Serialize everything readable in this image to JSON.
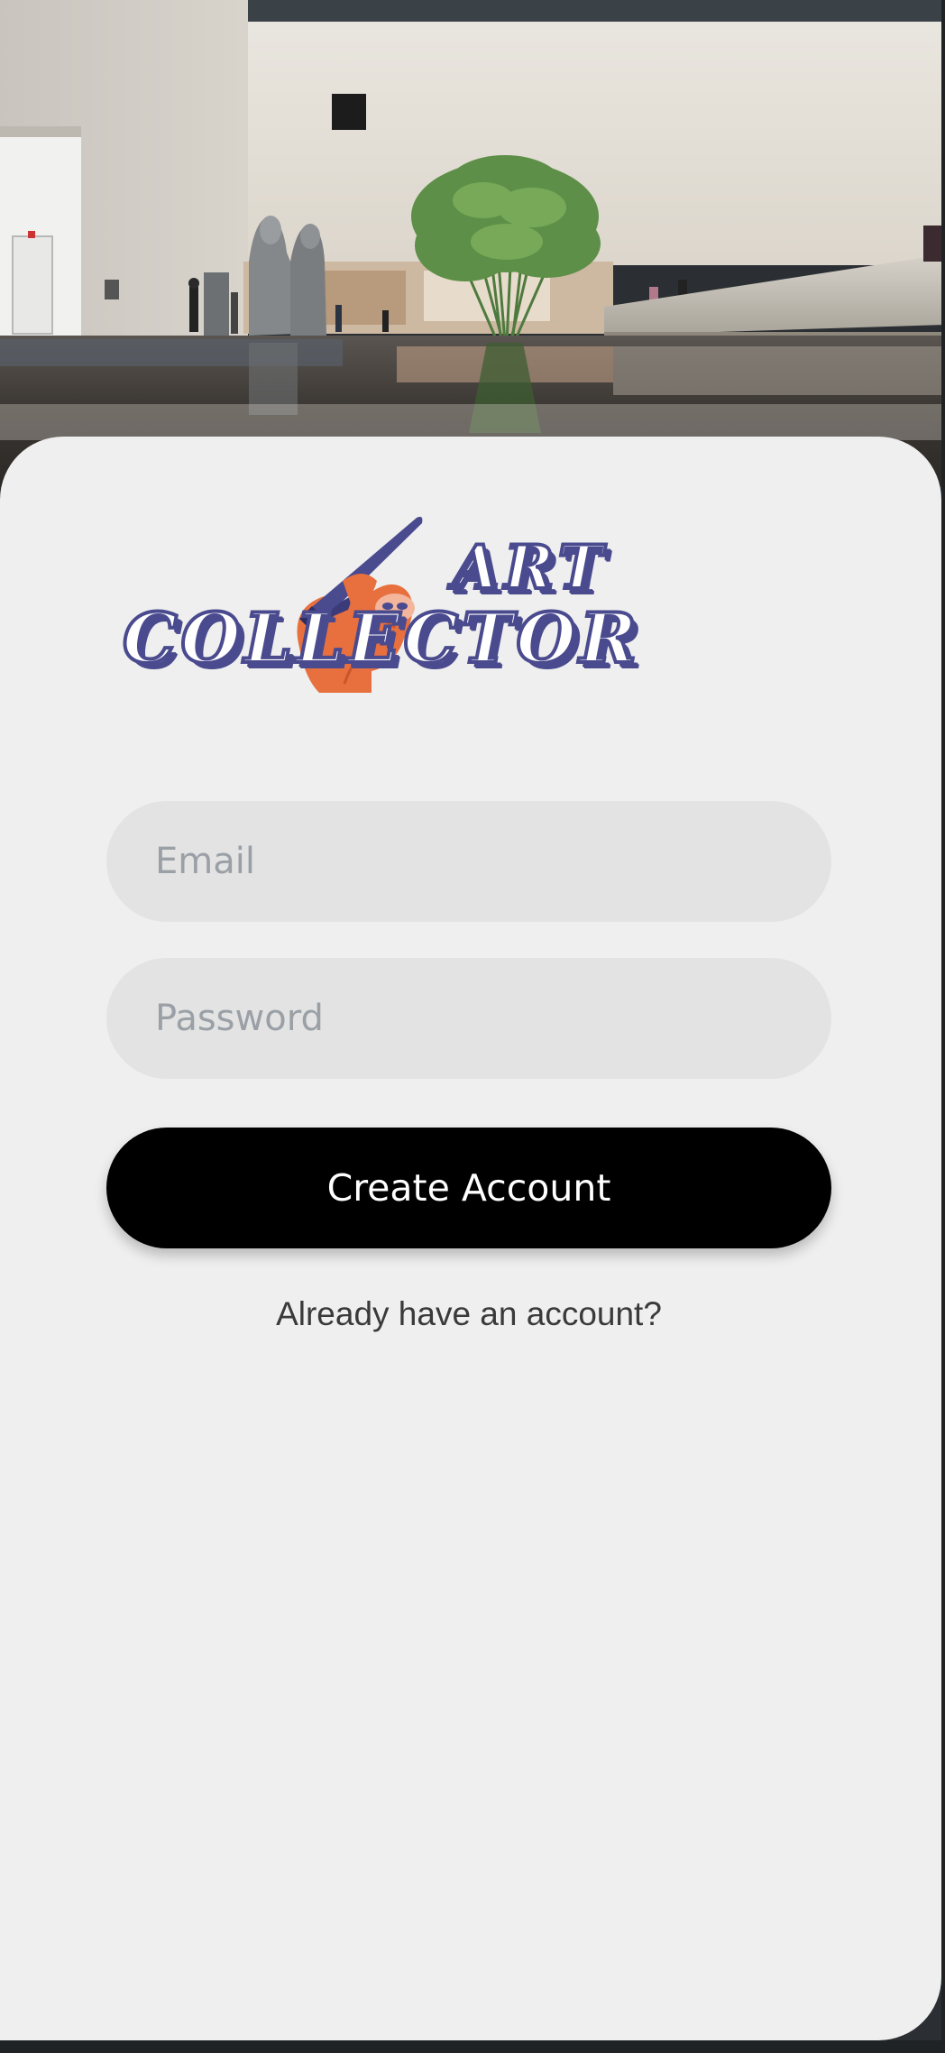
{
  "app": {
    "name": "Art Collector",
    "theme": {
      "sheet_background": "#efefef",
      "field_background": "#e3e3e3",
      "placeholder_color": "#9aa0a6",
      "button_background": "#000000",
      "button_text": "#ffffff",
      "logo_primary": "#4a4a8f",
      "logo_accent": "#e8703e"
    }
  },
  "hero": {
    "icon": "museum-photo"
  },
  "logo": {
    "line1": "ART",
    "line2": "COLLECTOR",
    "icon": "sloth-paintbrush-icon"
  },
  "form": {
    "email_placeholder": "Email",
    "email_value": "",
    "password_placeholder": "Password",
    "password_value": "",
    "submit_label": "Create Account",
    "signin_link": "Already have an account?"
  }
}
